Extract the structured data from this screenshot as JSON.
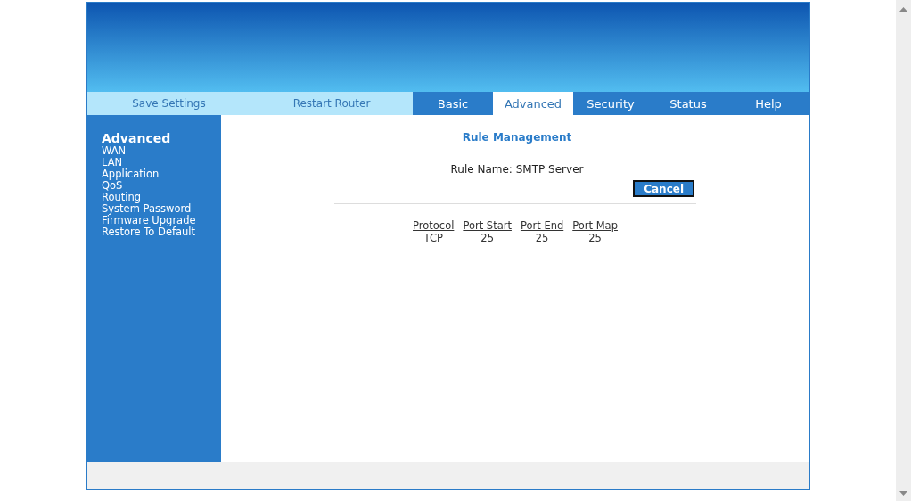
{
  "nav": {
    "actions": [
      "Save Settings",
      "Restart Router"
    ],
    "tabs": [
      {
        "label": "Basic",
        "selected": false
      },
      {
        "label": "Advanced",
        "selected": true
      },
      {
        "label": "Security",
        "selected": false
      },
      {
        "label": "Status",
        "selected": false
      },
      {
        "label": "Help",
        "selected": false
      }
    ]
  },
  "sidebar": {
    "title": "Advanced",
    "items": [
      "WAN",
      "LAN",
      "Application",
      "QoS",
      "Routing",
      "System Password",
      "Firmware Upgrade",
      "Restore To Default"
    ]
  },
  "main": {
    "title": "Rule Management",
    "rule_label": "Rule Name:",
    "rule_name": "SMTP Server",
    "cancel_button": "Cancel",
    "table": {
      "columns": [
        "Protocol",
        "Port Start",
        "Port End",
        "Port Map"
      ],
      "rows": [
        [
          "TCP",
          "25",
          "25",
          "25"
        ]
      ]
    }
  }
}
